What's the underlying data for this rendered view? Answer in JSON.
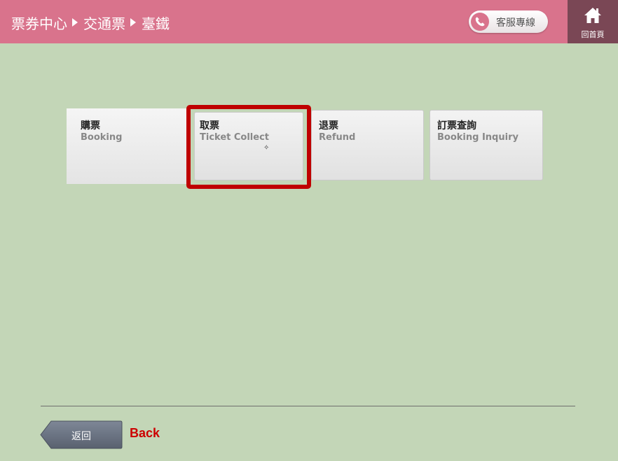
{
  "header": {
    "breadcrumb": [
      "票券中心",
      "交通票",
      "臺鐵"
    ],
    "service_label": "客服專線",
    "home_label": "回首頁"
  },
  "tiles": [
    {
      "title": "購票",
      "subtitle": "Booking"
    },
    {
      "title": "取票",
      "subtitle": "Ticket Collect"
    },
    {
      "title": "退票",
      "subtitle": "Refund"
    },
    {
      "title": "訂票查詢",
      "subtitle": "Booking Inquiry"
    }
  ],
  "footer": {
    "back_label": "返回",
    "back_annotation": "Back"
  },
  "colors": {
    "header": "#d9738c",
    "home_button": "#7a4755",
    "background": "#c3d6b7",
    "highlight": "#bf0000",
    "annotation": "#cc0000"
  },
  "icons": {
    "phone": "phone-icon",
    "home": "home-icon",
    "breadcrumb_separator": "triangle-right-icon"
  }
}
